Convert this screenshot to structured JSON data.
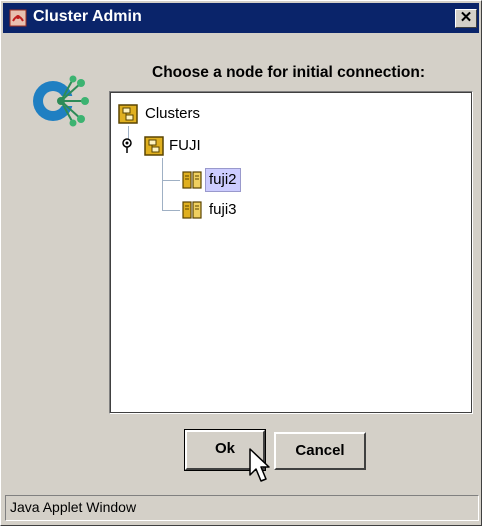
{
  "window": {
    "title": "Cluster Admin",
    "close_glyph": "✕"
  },
  "dialog": {
    "prompt": "Choose a node for initial connection:"
  },
  "tree": {
    "root": {
      "label": "Clusters",
      "icon": "cluster-folder-icon"
    },
    "cluster": {
      "label": "FUJI",
      "icon": "cluster-folder-icon",
      "expanded": true
    },
    "nodes": [
      {
        "label": "fuji2",
        "icon": "server-node-icon",
        "selected": true
      },
      {
        "label": "fuji3",
        "icon": "server-node-icon",
        "selected": false
      }
    ]
  },
  "buttons": {
    "ok_label": "Ok",
    "cancel_label": "Cancel"
  },
  "status": {
    "text": "Java Applet Window"
  },
  "colors": {
    "titlebar": "#0a246a",
    "dialog_bg": "#d4d0c8",
    "selection": "#ccccff"
  }
}
